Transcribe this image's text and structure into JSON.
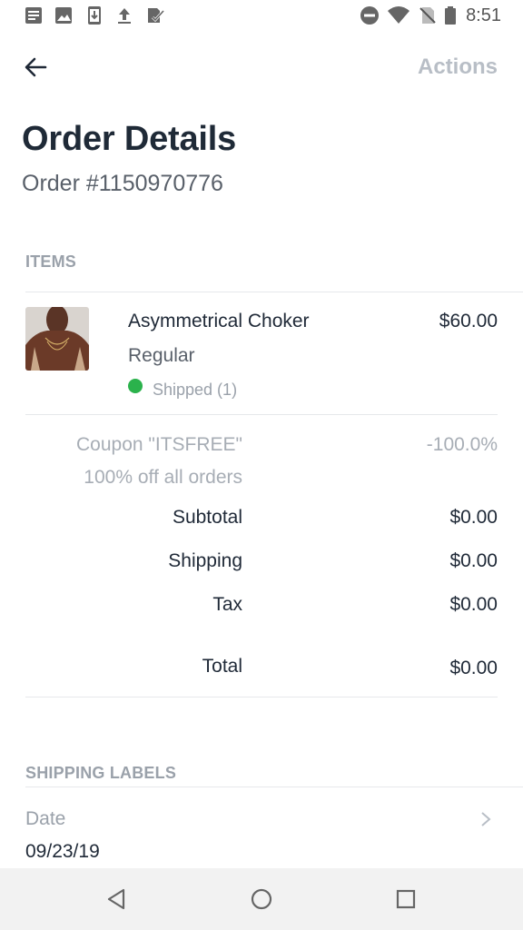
{
  "status_bar": {
    "time": "8:51",
    "left_icons": [
      "notes-icon",
      "image-icon",
      "download-icon",
      "upload-icon",
      "check-list-icon"
    ],
    "right_icons": [
      "do-not-disturb-icon",
      "wifi-icon",
      "no-sim-icon",
      "battery-icon"
    ]
  },
  "header": {
    "actions_label": "Actions"
  },
  "order": {
    "title": "Order Details",
    "number": "Order #1150970776"
  },
  "items_section": {
    "label": "ITEMS",
    "items": [
      {
        "name": "Asymmetrical Choker",
        "price": "$60.00",
        "variant": "Regular",
        "status": "Shipped (1)",
        "status_color": "#2bb24c"
      }
    ]
  },
  "summary": {
    "coupon_label": "Coupon \"ITSFREE\"",
    "coupon_value": "-100.0%",
    "coupon_description": "100% off all orders",
    "subtotal_label": "Subtotal",
    "subtotal_value": "$0.00",
    "shipping_label": "Shipping",
    "shipping_value": "$0.00",
    "tax_label": "Tax",
    "tax_value": "$0.00",
    "total_label": "Total",
    "total_value": "$0.00"
  },
  "shipping_labels_section": {
    "label": "SHIPPING LABELS",
    "date_label": "Date",
    "date_value": "09/23/19"
  },
  "nav_bar": {
    "buttons": [
      "back-triangle-icon",
      "home-circle-icon",
      "recents-square-icon"
    ]
  }
}
